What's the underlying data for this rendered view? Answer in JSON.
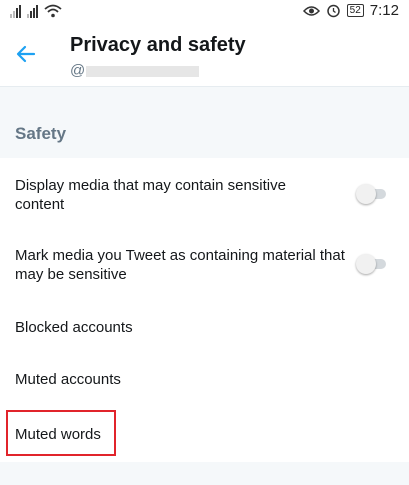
{
  "status_bar": {
    "time": "7:12",
    "battery": "52",
    "icons": [
      "signal-icon",
      "signal-icon",
      "wifi-icon",
      "eye-icon",
      "alarm-icon",
      "battery-icon"
    ]
  },
  "header": {
    "title": "Privacy and safety",
    "handle_prefix": "@",
    "back_icon": "back-arrow-icon"
  },
  "section": {
    "title": "Safety"
  },
  "settings": [
    {
      "label": "Display media that may contain sensitive content",
      "toggle": false
    },
    {
      "label": "Mark media you Tweet as containing material that may be sensitive",
      "toggle": false
    },
    {
      "label": "Blocked accounts"
    },
    {
      "label": "Muted accounts"
    },
    {
      "label": "Muted words",
      "highlighted": true
    }
  ],
  "colors": {
    "accent": "#1da1f2",
    "highlight_border": "#e1242b",
    "section_bg": "#f5f8fa",
    "section_text": "#657786"
  }
}
